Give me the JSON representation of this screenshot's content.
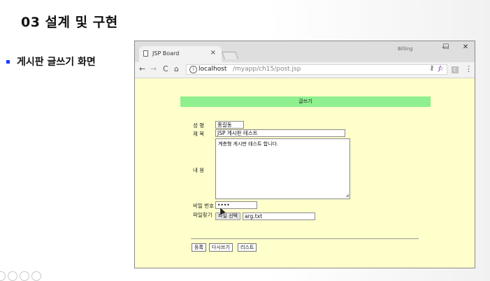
{
  "slide": {
    "title": "03 설계 및 구현",
    "bullet": "게시판 글쓰기 화면"
  },
  "browser": {
    "tab_title": "JSP Board",
    "tab_close": "×",
    "user_label": "Billing",
    "window_controls": {
      "minimize": "—",
      "maximize": "☐",
      "close": "✕"
    },
    "nav": {
      "back": "←",
      "forward": "→",
      "reload": "C",
      "home": "⌂"
    },
    "url_host": "localhost",
    "url_path": "/myapp/ch15/post.jsp",
    "extension_label": "C",
    "menu": "⋮"
  },
  "form": {
    "header": "글쓰기",
    "labels": {
      "name": "성 명",
      "subject": "제 목",
      "content": "내 용",
      "password": "비밀 번호",
      "file": "파일찾기"
    },
    "values": {
      "name": "홍길동",
      "subject": "JSP 게시판 테스트",
      "content": "계층형 게시판 테스트 합니다.",
      "password": "••••",
      "file_button": "파일 선택",
      "file_name": "arg.txt"
    },
    "buttons": {
      "submit": "등록",
      "rewrite": "다시쓰기",
      "list": "리스트"
    }
  },
  "colors": {
    "page_bg": "#ffffcc",
    "header_bg": "#8ef08e",
    "bullet": "#1a3cff"
  }
}
